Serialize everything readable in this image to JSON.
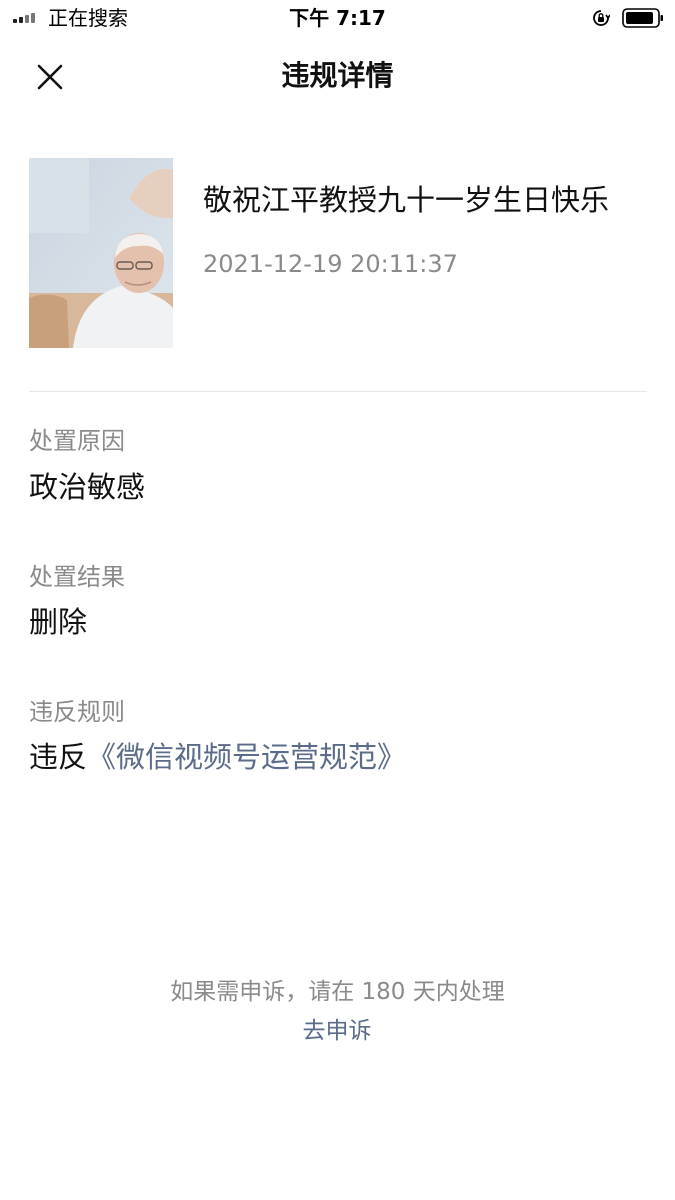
{
  "status_bar": {
    "carrier": "正在搜索",
    "time": "下午 7:17",
    "icons": [
      "signal-icon",
      "orientation-lock-icon",
      "battery-icon"
    ]
  },
  "nav": {
    "title": "违规详情",
    "close_icon": "close-icon"
  },
  "content": {
    "thumbnail_icon": "video-thumbnail",
    "title": "敬祝江平教授九十一岁生日快乐",
    "time": "2021-12-19 20:11:37"
  },
  "details": {
    "reason_label": "处置原因",
    "reason_value": "政治敏感",
    "result_label": "处置结果",
    "result_value": "删除",
    "rule_label": "违反规则",
    "rule_prefix": "违反",
    "rule_link": "《微信视频号运营规范》"
  },
  "footer": {
    "appeal_note": "如果需申诉，请在 180 天内处理",
    "appeal_link": "去申诉"
  },
  "colors": {
    "link": "#5b6b8a",
    "secondary_text": "#8a8a8a",
    "divider": "#e6e6e6"
  }
}
